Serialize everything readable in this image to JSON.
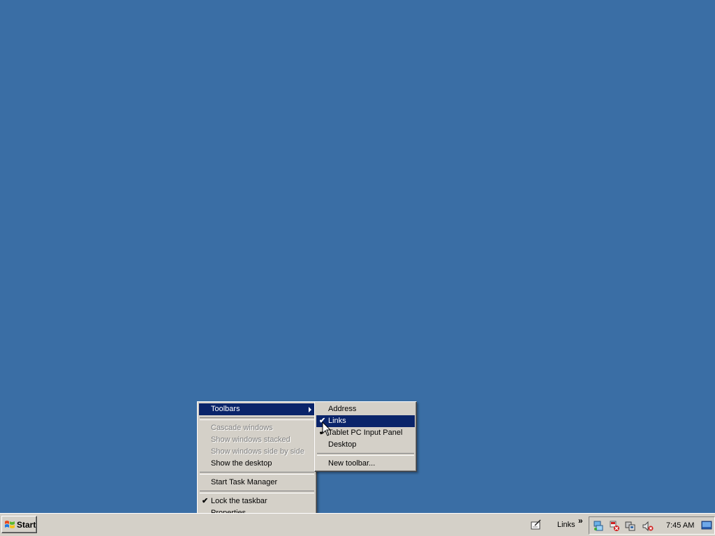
{
  "taskbar": {
    "start_label": "Start",
    "links_label": "Links",
    "links_chevron": "»",
    "clock": "7:45 AM"
  },
  "context_menu": {
    "items": [
      {
        "label": "Toolbars",
        "has_submenu": true,
        "selected": true
      },
      {
        "label": "Cascade windows",
        "disabled": true
      },
      {
        "label": "Show windows stacked",
        "disabled": true
      },
      {
        "label": "Show windows side by side",
        "disabled": true
      },
      {
        "label": "Show the desktop"
      },
      {
        "label": "Start Task Manager"
      },
      {
        "label": "Lock the taskbar",
        "checked": true
      },
      {
        "label": "Properties"
      }
    ]
  },
  "toolbars_submenu": {
    "items": [
      {
        "label": "Address"
      },
      {
        "label": "Links",
        "checked": true,
        "selected": true
      },
      {
        "label": "Tablet PC Input Panel",
        "checked": true
      },
      {
        "label": "Desktop"
      },
      {
        "label": "New toolbar..."
      }
    ]
  },
  "colors": {
    "desktop": "#3a6ea5",
    "taskbar": "#d4d0c8",
    "highlight": "#0a246a"
  },
  "icons": {
    "tray": [
      "network-icon",
      "security-alert-icon",
      "connection-icon",
      "volume-muted-icon"
    ]
  }
}
